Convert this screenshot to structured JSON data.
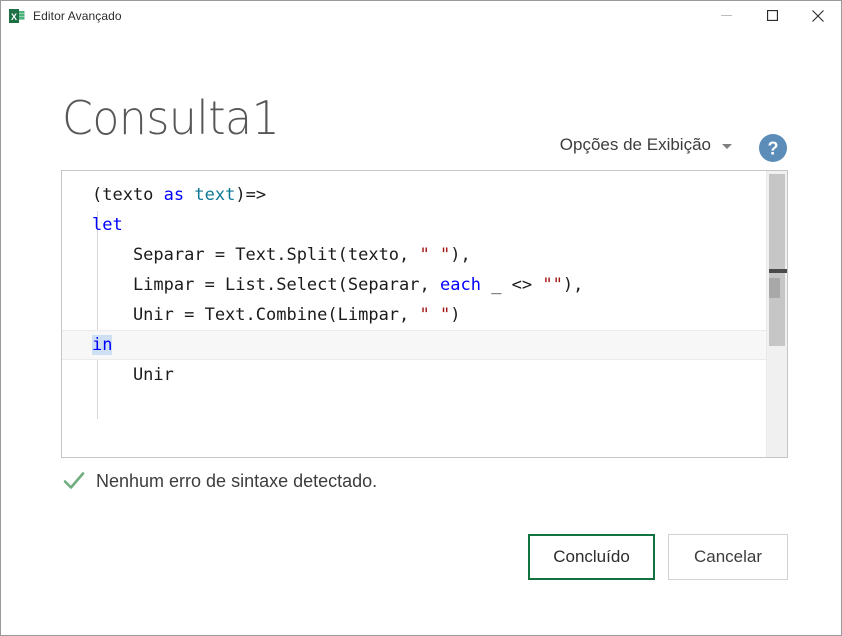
{
  "window": {
    "title": "Editor Avançado",
    "app_icon": "excel-icon",
    "controls": {
      "minimize": "minimize-icon",
      "maximize": "maximize-icon",
      "close": "close-icon"
    }
  },
  "header": {
    "page_title": "Consulta1",
    "view_options_label": "Opções de Exibição",
    "view_options_caret": "chevron-down-icon",
    "help_label": "?",
    "help_icon": "help-icon"
  },
  "editor": {
    "lines": [
      {
        "current": false,
        "tokens": [
          {
            "text": "(texto ",
            "type": "plain"
          },
          {
            "text": "as",
            "type": "keyword"
          },
          {
            "text": " ",
            "type": "plain"
          },
          {
            "text": "text",
            "type": "type"
          },
          {
            "text": ")=>",
            "type": "plain"
          }
        ]
      },
      {
        "current": false,
        "tokens": [
          {
            "text": "let",
            "type": "keyword"
          }
        ]
      },
      {
        "current": false,
        "tokens": [
          {
            "text": "    Separar = Text.Split(texto, ",
            "type": "plain"
          },
          {
            "text": "\" \"",
            "type": "string"
          },
          {
            "text": "),",
            "type": "plain"
          }
        ]
      },
      {
        "current": false,
        "tokens": [
          {
            "text": "    Limpar = List.Select(Separar, ",
            "type": "plain"
          },
          {
            "text": "each",
            "type": "keyword"
          },
          {
            "text": " _ <> ",
            "type": "plain"
          },
          {
            "text": "\"\"",
            "type": "string"
          },
          {
            "text": "),",
            "type": "plain"
          }
        ]
      },
      {
        "current": false,
        "tokens": [
          {
            "text": "    Unir = Text.Combine(Limpar, ",
            "type": "plain"
          },
          {
            "text": "\" \"",
            "type": "string"
          },
          {
            "text": ")",
            "type": "plain"
          }
        ]
      },
      {
        "current": true,
        "tokens": [
          {
            "text": "in",
            "type": "keyword-selected"
          }
        ]
      },
      {
        "current": false,
        "tokens": [
          {
            "text": "    Unir",
            "type": "plain"
          }
        ]
      }
    ],
    "scrollbar": {
      "name": "vertical-scrollbar",
      "thumb": "scrollbar-thumb",
      "splitter": "scrollbar-splitter"
    }
  },
  "status": {
    "icon": "checkmark-icon",
    "message": "Nenhum erro de sintaxe detectado."
  },
  "footer": {
    "done_label": "Concluído",
    "cancel_label": "Cancelar"
  },
  "colors": {
    "keyword": "#0000ff",
    "type": "#0e7a96",
    "string": "#a31515",
    "selection": "#cfe0f5",
    "primary_border": "#11713f",
    "help_blue": "#5b8db8",
    "check_green": "#70ad7f"
  }
}
